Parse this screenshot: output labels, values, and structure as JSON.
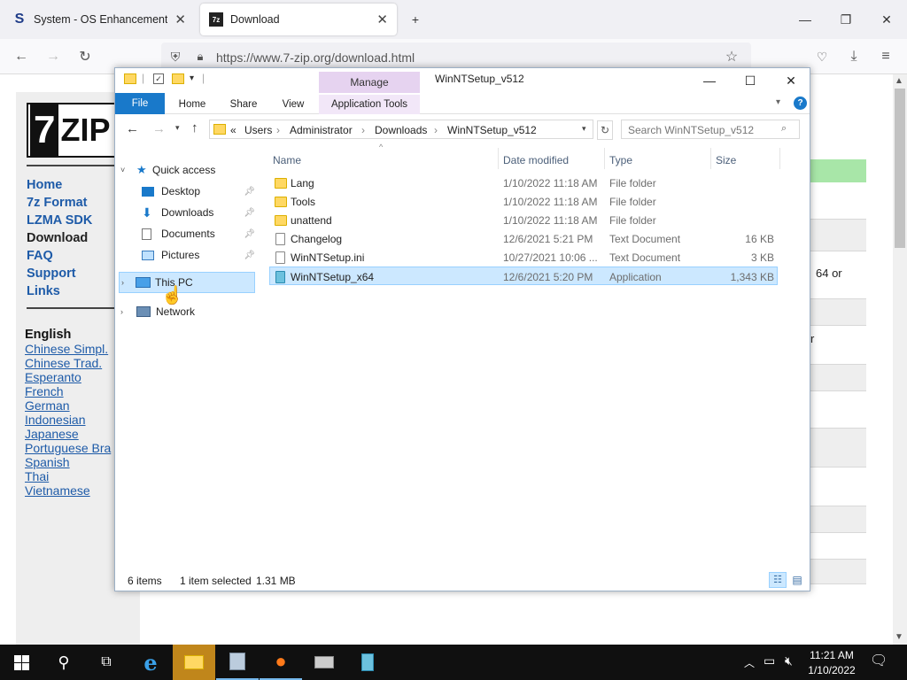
{
  "browser": {
    "tabs": [
      {
        "title": "System - OS Enhancements Do",
        "favicon": "S"
      },
      {
        "title": "Download",
        "favicon": "7z"
      }
    ],
    "new_tab": "+",
    "url": "https://www.7-zip.org/download.html",
    "window_controls": {
      "minimize": "—",
      "restore": "❐",
      "close": "✕"
    }
  },
  "site": {
    "logo": {
      "seven": "7",
      "zip": "ZIP"
    },
    "nav": [
      "Home",
      "7z Format",
      "LZMA SDK",
      "Download",
      "FAQ",
      "Support",
      "Links"
    ],
    "current_nav": "Download",
    "lang_heading": "English",
    "languages": [
      "Chinese Simpl.",
      "Chinese Trad.",
      "Esperanto",
      "French",
      "German",
      "Indonesian",
      "Japanese",
      "Portuguese Bra",
      "Spanish",
      "Thai",
      "Vietnamese"
    ],
    "right_fragments": {
      "a": "64 or",
      "b": "r"
    },
    "accent_green": "#a8e6a8"
  },
  "explorer": {
    "qat_separator": "|",
    "context_tab": "Manage",
    "window_title": "WinNTSetup_v512",
    "ribbon_tabs": [
      "File",
      "Home",
      "Share",
      "View",
      "Application Tools"
    ],
    "breadcrumb": [
      "«",
      "Users",
      "Administrator",
      "Downloads",
      "WinNTSetup_v512"
    ],
    "search_placeholder": "Search WinNTSetup_v512",
    "nav": {
      "quick_access": "Quick access",
      "pinned": [
        "Desktop",
        "Downloads",
        "Documents",
        "Pictures"
      ],
      "this_pc": "This PC",
      "network": "Network"
    },
    "columns": [
      "Name",
      "Date modified",
      "Type",
      "Size"
    ],
    "files": [
      {
        "name": "Lang",
        "date": "1/10/2022 11:18 AM",
        "type": "File folder",
        "size": "",
        "icon": "folder"
      },
      {
        "name": "Tools",
        "date": "1/10/2022 11:18 AM",
        "type": "File folder",
        "size": "",
        "icon": "folder"
      },
      {
        "name": "unattend",
        "date": "1/10/2022 11:18 AM",
        "type": "File folder",
        "size": "",
        "icon": "folder"
      },
      {
        "name": "Changelog",
        "date": "12/6/2021 5:21 PM",
        "type": "Text Document",
        "size": "16 KB",
        "icon": "doc"
      },
      {
        "name": "WinNTSetup.ini",
        "date": "10/27/2021 10:06 ...",
        "type": "Text Document",
        "size": "3 KB",
        "icon": "doc"
      },
      {
        "name": "WinNTSetup_x64",
        "date": "12/6/2021 5:20 PM",
        "type": "Application",
        "size": "1,343 KB",
        "icon": "app"
      }
    ],
    "status": {
      "items": "6 items",
      "selected": "1 item selected",
      "size": "1.31 MB"
    },
    "colors": {
      "file_tab": "#1979ca",
      "context_tab": "#e6d3f0",
      "selection": "#cce8ff"
    }
  },
  "taskbar": {
    "time": "11:21 AM",
    "date": "1/10/2022"
  }
}
